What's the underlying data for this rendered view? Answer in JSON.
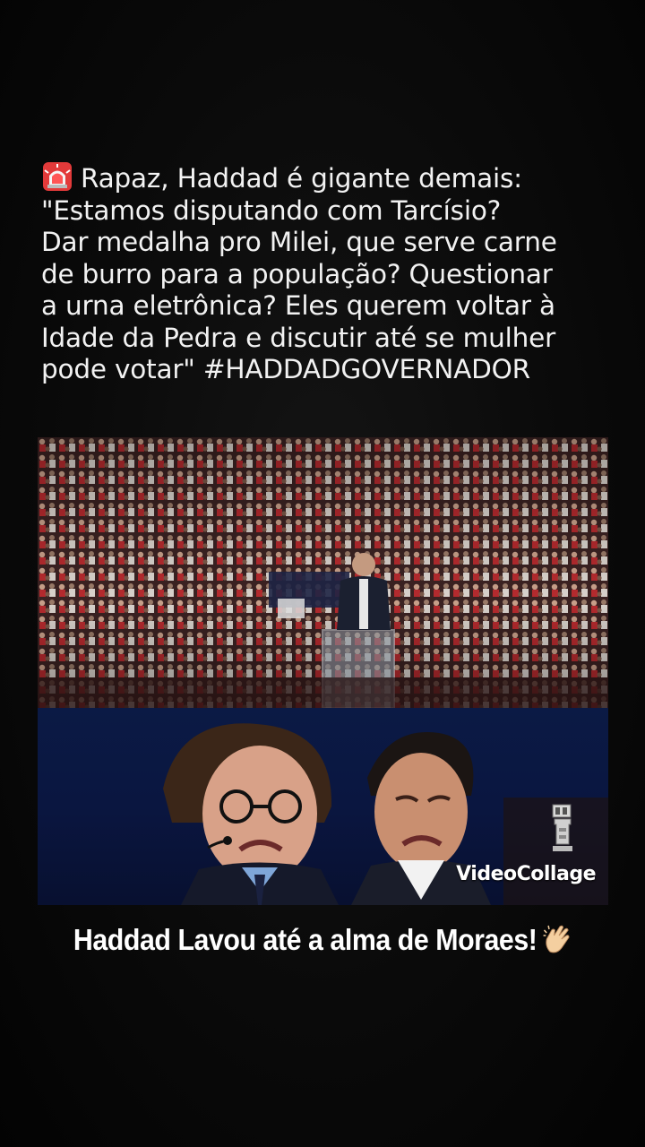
{
  "post": {
    "icon": "rotating-light-icon",
    "lines": [
      "Rapaz, Haddad é gigante demais:",
      "\"Estamos disputando com Tarcísio?",
      "Dar medalha pro Milei, que serve carne",
      "de burro para a população? Questionar",
      "a urna eletrônica? Eles querem voltar à",
      "Idade da Pedra e discutir até se mulher",
      "pode votar\" #HADDADGOVERNADOR"
    ]
  },
  "media": {
    "watermark": "VideoCollage"
  },
  "caption": {
    "text": "Haddad Lavou até a alma de Moraes!",
    "icon": "clapping-hands-icon"
  },
  "colors": {
    "background": "#060606",
    "text": "#f2f2f2",
    "crowd_red": "#b3262b",
    "panel_blue": "#0b1a45"
  }
}
